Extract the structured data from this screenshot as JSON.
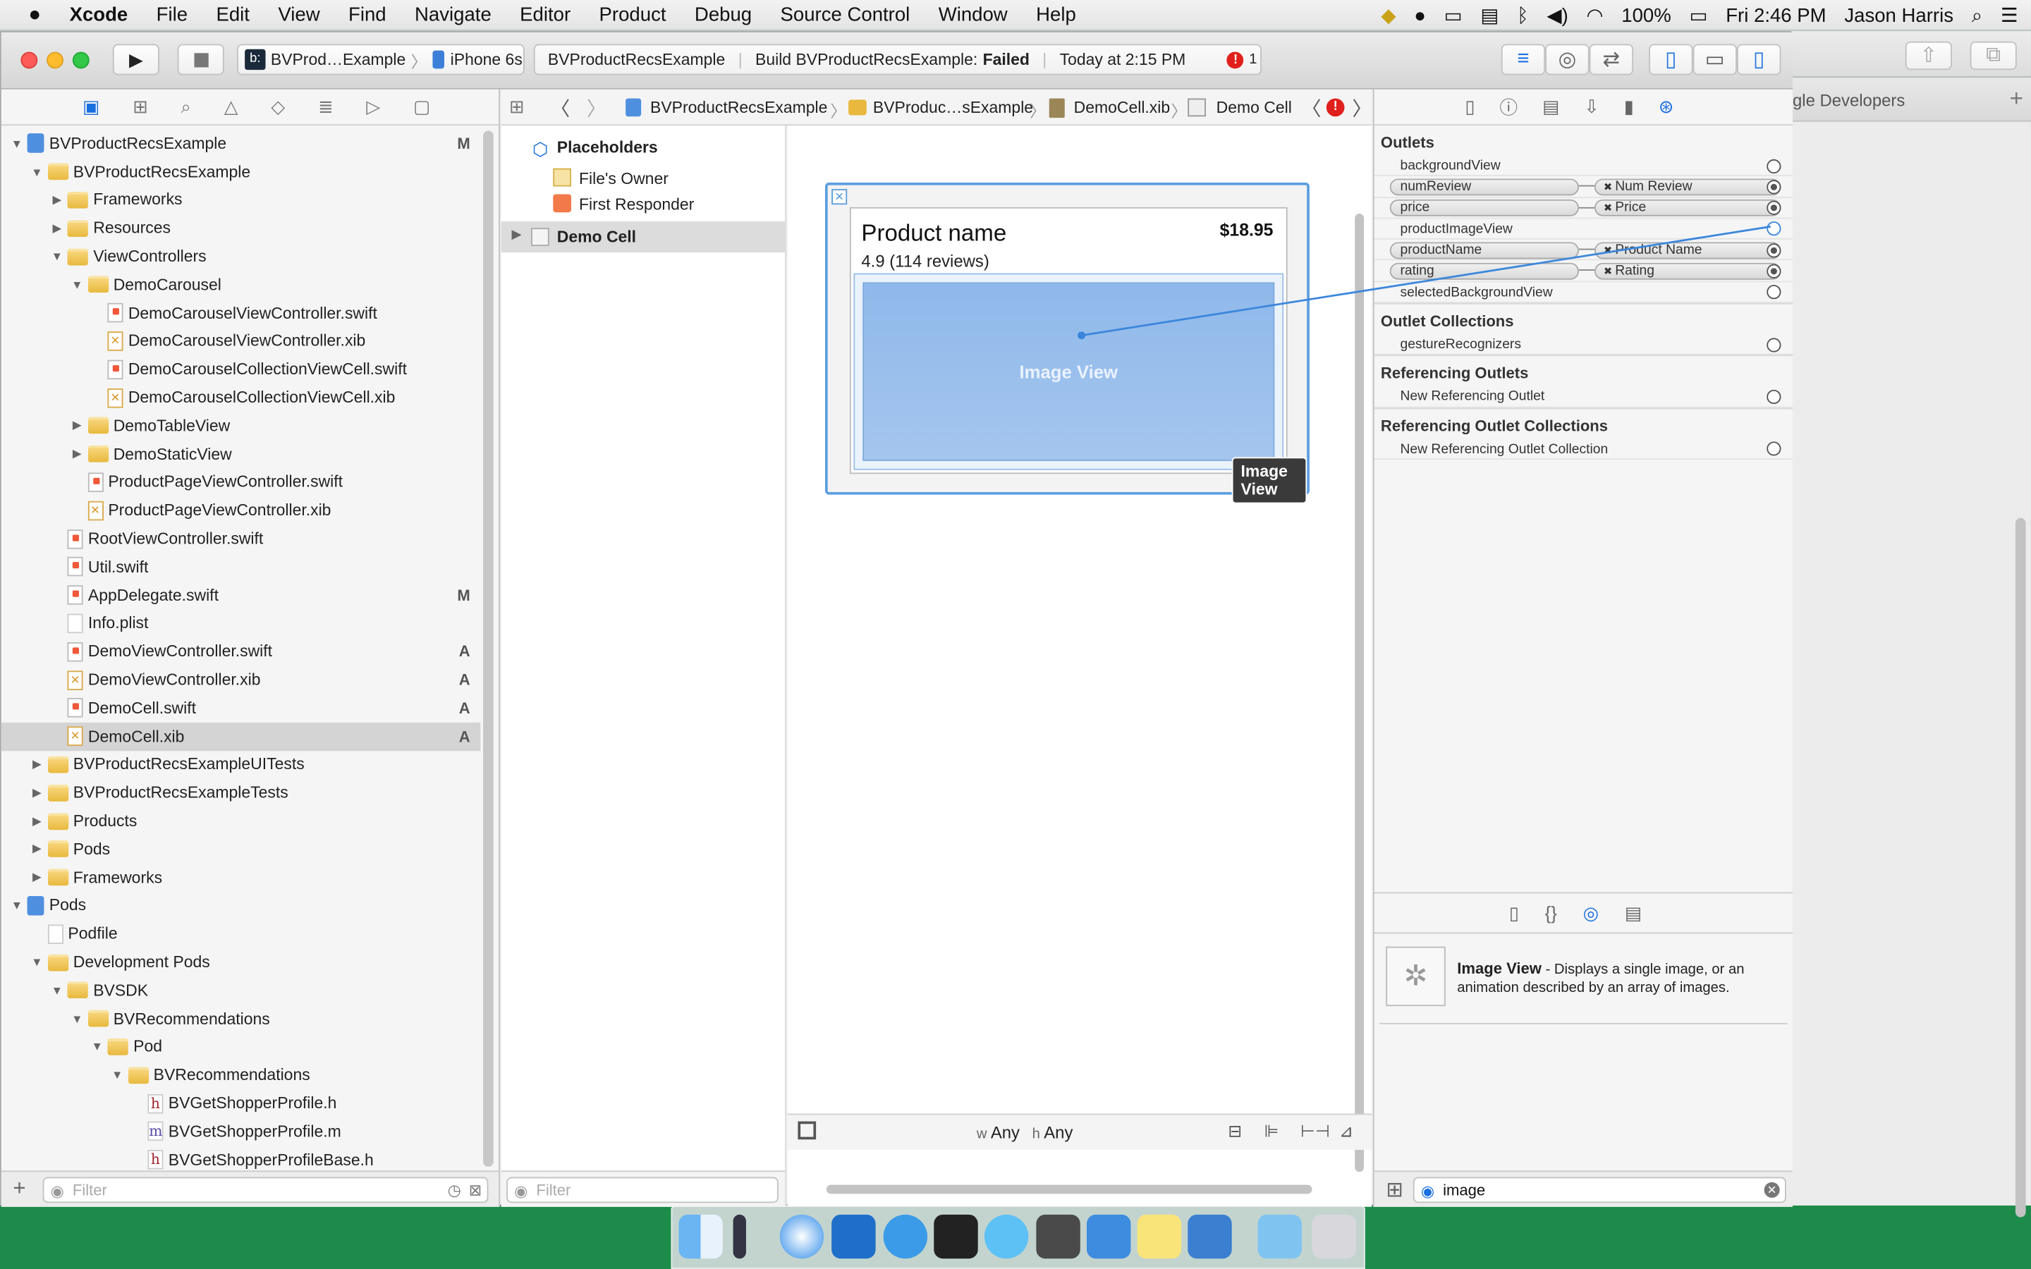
{
  "menubar": {
    "items": [
      "Xcode",
      "File",
      "Edit",
      "View",
      "Find",
      "Navigate",
      "Editor",
      "Product",
      "Debug",
      "Source Control",
      "Window",
      "Help"
    ],
    "battery": "100%",
    "clock": "Fri 2:46 PM",
    "user": "Jason Harris"
  },
  "toolbar": {
    "scheme": "BVProd…Example",
    "device": "iPhone 6s",
    "activity_project": "BVProductRecsExample",
    "activity_build": "Build BVProductRecsExample:",
    "activity_status": "Failed",
    "activity_time": "Today at 2:15 PM",
    "error_count": "1"
  },
  "navigator": {
    "items": [
      {
        "label": "BVProductRecsExample",
        "badge": "M"
      },
      {
        "label": "BVProductRecsExample",
        "badge": ""
      },
      {
        "label": "Frameworks",
        "badge": ""
      },
      {
        "label": "Resources",
        "badge": ""
      },
      {
        "label": "ViewControllers",
        "badge": ""
      },
      {
        "label": "DemoCarousel",
        "badge": ""
      },
      {
        "label": "DemoCarouselViewController.swift",
        "badge": ""
      },
      {
        "label": "DemoCarouselViewController.xib",
        "badge": ""
      },
      {
        "label": "DemoCarouselCollectionViewCell.swift",
        "badge": ""
      },
      {
        "label": "DemoCarouselCollectionViewCell.xib",
        "badge": ""
      },
      {
        "label": "DemoTableView",
        "badge": ""
      },
      {
        "label": "DemoStaticView",
        "badge": ""
      },
      {
        "label": "ProductPageViewController.swift",
        "badge": ""
      },
      {
        "label": "ProductPageViewController.xib",
        "badge": ""
      },
      {
        "label": "RootViewController.swift",
        "badge": ""
      },
      {
        "label": "Util.swift",
        "badge": ""
      },
      {
        "label": "AppDelegate.swift",
        "badge": "M"
      },
      {
        "label": "Info.plist",
        "badge": ""
      },
      {
        "label": "DemoViewController.swift",
        "badge": "A"
      },
      {
        "label": "DemoViewController.xib",
        "badge": "A"
      },
      {
        "label": "DemoCell.swift",
        "badge": "A"
      },
      {
        "label": "DemoCell.xib",
        "badge": "A"
      },
      {
        "label": "BVProductRecsExampleUITests",
        "badge": ""
      },
      {
        "label": "BVProductRecsExampleTests",
        "badge": ""
      },
      {
        "label": "Products",
        "badge": ""
      },
      {
        "label": "Pods",
        "badge": ""
      },
      {
        "label": "Frameworks",
        "badge": ""
      },
      {
        "label": "Pods",
        "badge": ""
      },
      {
        "label": "Podfile",
        "badge": ""
      },
      {
        "label": "Development Pods",
        "badge": ""
      },
      {
        "label": "BVSDK",
        "badge": ""
      },
      {
        "label": "BVRecommendations",
        "badge": ""
      },
      {
        "label": "Pod",
        "badge": ""
      },
      {
        "label": "BVRecommendations",
        "badge": ""
      },
      {
        "label": "BVGetShopperProfile.h",
        "badge": ""
      },
      {
        "label": "BVGetShopperProfile.m",
        "badge": ""
      },
      {
        "label": "BVGetShopperProfileBase.h",
        "badge": ""
      }
    ],
    "filter_placeholder": "Filter"
  },
  "jumpbar": {
    "crumbs": [
      "BVProductRecsExample",
      "BVProduc…sExample",
      "DemoCell.xib",
      "Demo Cell"
    ]
  },
  "outline": {
    "placeholders": "Placeholders",
    "files_owner": "File's Owner",
    "first_responder": "First Responder",
    "demo_cell": "Demo Cell",
    "filter_placeholder": "Filter"
  },
  "canvas": {
    "product_name": "Product name",
    "price": "$18.95",
    "rating": "4.9 (114 reviews)",
    "image_label": "Image View",
    "tooltip": "Image View",
    "size_w": "Any",
    "size_h": "Any",
    "size_w_prefix": "w",
    "size_h_prefix": "h"
  },
  "inspector": {
    "outlets_header": "Outlets",
    "outlets": [
      {
        "name": "backgroundView",
        "target": ""
      },
      {
        "name": "numReview",
        "target": "Num Review"
      },
      {
        "name": "price",
        "target": "Price"
      },
      {
        "name": "productImageView",
        "target": ""
      },
      {
        "name": "productName",
        "target": "Product Name"
      },
      {
        "name": "rating",
        "target": "Rating"
      },
      {
        "name": "selectedBackgroundView",
        "target": ""
      }
    ],
    "outlet_collections_header": "Outlet Collections",
    "gesture": "gestureRecognizers",
    "ref_outlets_header": "Referencing Outlets",
    "new_ref_outlet": "New Referencing Outlet",
    "ref_collections_header": "Referencing Outlet Collections",
    "new_ref_collection": "New Referencing Outlet Collection",
    "library_title": "Image View",
    "library_desc": " - Displays a single image, or an animation described by an array of images.",
    "search_value": "image"
  },
  "background_window": {
    "tab_text": "gle Developers"
  },
  "colors": {
    "accent": "#1a6fe0",
    "error": "#e0201c",
    "selection": "#d4d4d4"
  }
}
